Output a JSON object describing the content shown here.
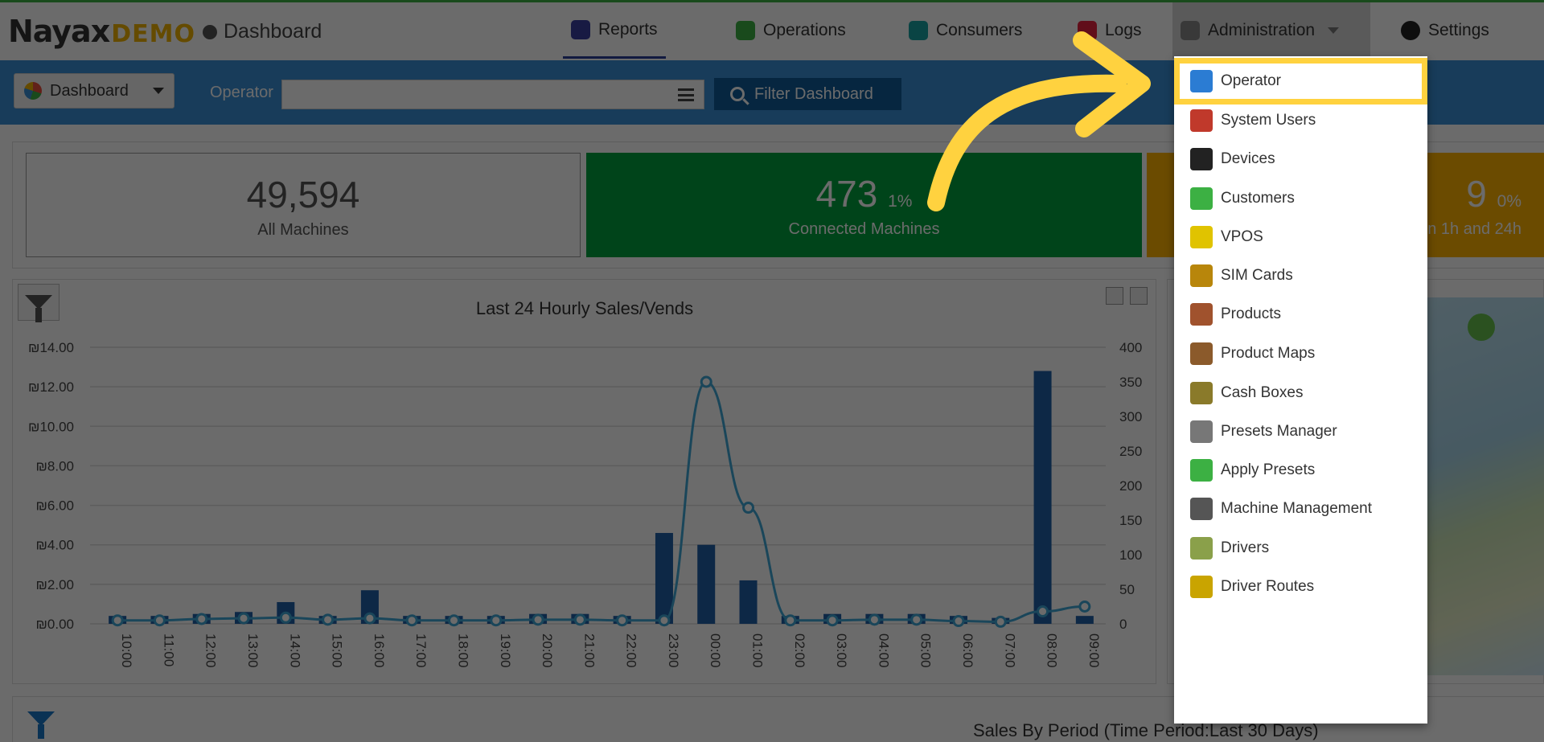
{
  "brand": {
    "logo": "Nayax",
    "logo_suffix": "DEMO",
    "breadcrumb": "Dashboard"
  },
  "nav": [
    {
      "label": "Reports",
      "icon": "reports-icon",
      "color": "#3b3fa0"
    },
    {
      "label": "Operations",
      "icon": "operations-icon",
      "color": "#3cb043"
    },
    {
      "label": "Consumers",
      "icon": "consumers-icon",
      "color": "#1aa3a3"
    },
    {
      "label": "Logs",
      "icon": "logs-icon",
      "color": "#e8233f"
    },
    {
      "label": "Administration",
      "icon": "administration-icon",
      "color": "#888888"
    },
    {
      "label": "Settings",
      "icon": "gear-icon",
      "color": "#222222"
    }
  ],
  "filterbar": {
    "dashboard_select": "Dashboard",
    "operator_label": "Operator",
    "operator_value": "",
    "filter_button": "Filter Dashboard"
  },
  "cards": [
    {
      "value": "49,594",
      "percent": "",
      "label": "All Machines"
    },
    {
      "value": "473",
      "percent": "1%",
      "label": "Connected Machines"
    },
    {
      "value": "9",
      "percent": "0%",
      "label": "n 1h and 24h"
    }
  ],
  "chart_data": {
    "type": "bar",
    "title": "Last 24 Hourly Sales/Vends",
    "categories": [
      "10:00",
      "11:00",
      "12:00",
      "13:00",
      "14:00",
      "15:00",
      "16:00",
      "17:00",
      "18:00",
      "19:00",
      "20:00",
      "21:00",
      "22:00",
      "23:00",
      "00:00",
      "01:00",
      "02:00",
      "03:00",
      "04:00",
      "05:00",
      "06:00",
      "07:00",
      "08:00",
      "09:00"
    ],
    "y_left_ticks": [
      "₪14.00",
      "₪12.00",
      "₪10.00",
      "₪8.00",
      "₪6.00",
      "₪4.00",
      "₪2.00",
      "₪0.00"
    ],
    "y_right_ticks": [
      "400",
      "350",
      "300",
      "250",
      "200",
      "150",
      "100",
      "50",
      "0"
    ],
    "ylim_left": [
      0,
      14
    ],
    "ylim_right": [
      0,
      400
    ],
    "grid": true,
    "series": [
      {
        "axis": "left",
        "style": "bar",
        "color": "#1f5fa8",
        "values": [
          0.4,
          0.4,
          0.5,
          0.6,
          1.1,
          0.4,
          1.7,
          0.4,
          0.4,
          0.4,
          0.5,
          0.5,
          0.4,
          4.6,
          4.0,
          2.2,
          0.4,
          0.5,
          0.5,
          0.5,
          0.4,
          0.3,
          12.8,
          0.4
        ]
      },
      {
        "axis": "right",
        "style": "line",
        "color": "#3fa7d6",
        "values": [
          5,
          5,
          7,
          8,
          9,
          6,
          8,
          5,
          5,
          5,
          6,
          6,
          5,
          5,
          350,
          168,
          5,
          5,
          6,
          6,
          4,
          3,
          18,
          25
        ]
      }
    ]
  },
  "period_panel": {
    "title": "Sales By Period (Time Period:Last 30 Days)"
  },
  "admin_menu": {
    "items": [
      {
        "label": "Operator",
        "icon": "operator-icon",
        "color": "#2b7cd3",
        "highlighted": true
      },
      {
        "label": "System Users",
        "icon": "system-users-icon",
        "color": "#c0392b"
      },
      {
        "label": "Devices",
        "icon": "devices-icon",
        "color": "#222222"
      },
      {
        "label": "Customers",
        "icon": "customers-icon",
        "color": "#3cb043"
      },
      {
        "label": "VPOS",
        "icon": "vpos-icon",
        "color": "#e0c300"
      },
      {
        "label": "SIM Cards",
        "icon": "sim-cards-icon",
        "color": "#b8860b"
      },
      {
        "label": "Products",
        "icon": "products-icon",
        "color": "#a0522d"
      },
      {
        "label": "Product Maps",
        "icon": "product-maps-icon",
        "color": "#8b5a2b"
      },
      {
        "label": "Cash Boxes",
        "icon": "cash-boxes-icon",
        "color": "#8a7a2a"
      },
      {
        "label": "Presets Manager",
        "icon": "presets-manager-icon",
        "color": "#777777"
      },
      {
        "label": "Apply Presets",
        "icon": "apply-presets-icon",
        "color": "#3cb043"
      },
      {
        "label": "Machine Management",
        "icon": "machine-management-icon",
        "color": "#555555"
      },
      {
        "label": "Drivers",
        "icon": "drivers-icon",
        "color": "#8aa04a"
      },
      {
        "label": "Driver Routes",
        "icon": "driver-routes-icon",
        "color": "#c9a400"
      }
    ]
  },
  "annotation": {
    "arrow_color": "#ffd23f"
  }
}
